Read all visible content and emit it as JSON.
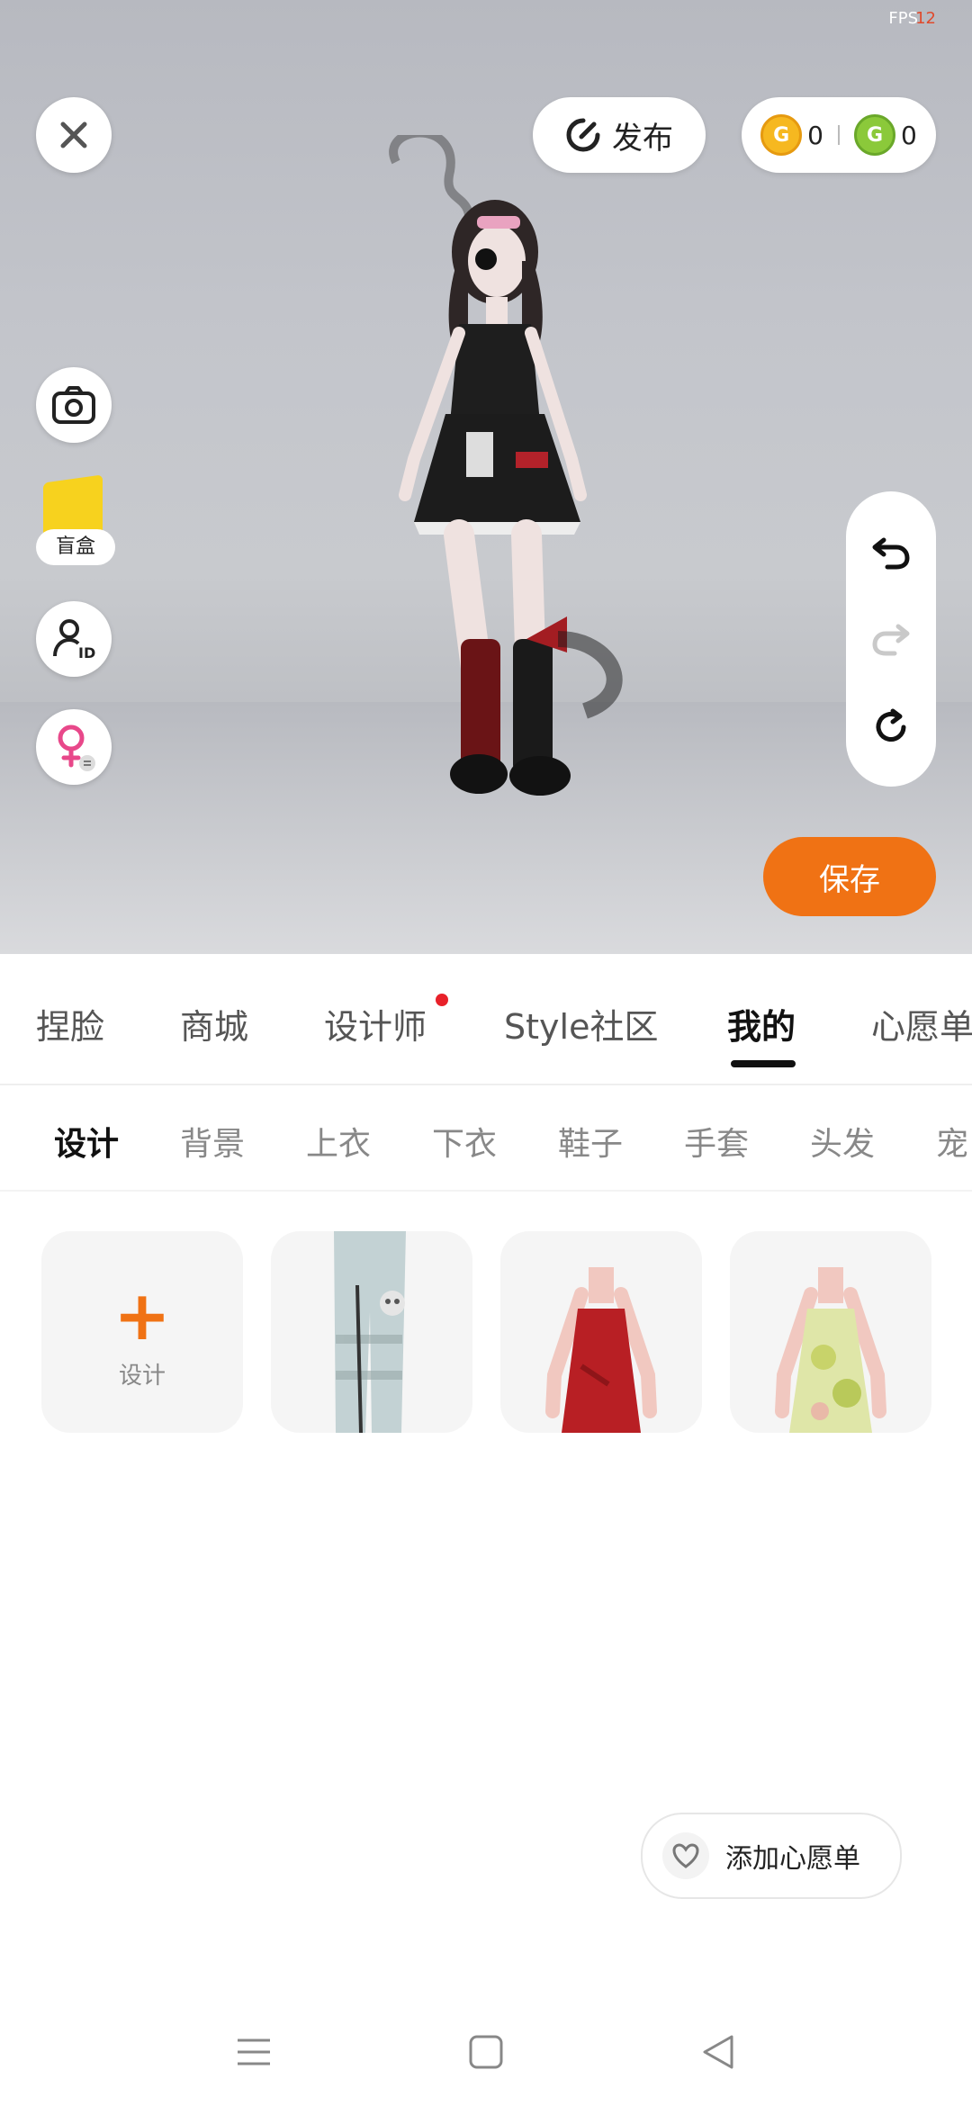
{
  "status": {
    "fps_label": "FPS",
    "fps_value": "12"
  },
  "top": {
    "close_icon": "close-icon",
    "publish_label": "发布",
    "coins": {
      "gold_value": "0",
      "green_value": "0",
      "gold_color": "#f6b820",
      "green_color": "#8bc93a"
    }
  },
  "left_tools": {
    "blind_box_label": "盲盒"
  },
  "actions": {
    "save_label": "保存"
  },
  "tabs": [
    {
      "label": "捏脸"
    },
    {
      "label": "商城"
    },
    {
      "label": "设计师"
    },
    {
      "label": "Style社区"
    },
    {
      "label": "我的"
    },
    {
      "label": "心愿单"
    }
  ],
  "subtabs": [
    {
      "label": "设计"
    },
    {
      "label": "背景"
    },
    {
      "label": "上衣"
    },
    {
      "label": "下衣"
    },
    {
      "label": "鞋子"
    },
    {
      "label": "手套"
    },
    {
      "label": "头发"
    },
    {
      "label": "宠"
    }
  ],
  "grid": {
    "add_label": "设计"
  },
  "wishlist": {
    "label": "添加心愿单"
  },
  "colors": {
    "accent": "#f07214",
    "notify_dot": "#e8212a"
  }
}
